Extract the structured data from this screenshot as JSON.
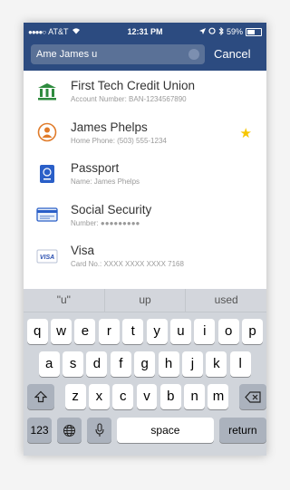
{
  "status_bar": {
    "carrier": "AT&T",
    "time": "12:31 PM",
    "battery": "59%",
    "battery_level": 0.59
  },
  "search": {
    "query": "Ame James u",
    "cancel_label": "Cancel"
  },
  "results": [
    {
      "icon": "bank-icon",
      "title": "First Tech Credit Union",
      "subtitle": "Account Number: BAN-1234567890",
      "favorite": false
    },
    {
      "icon": "contact-icon",
      "title": "James Phelps",
      "subtitle": "Home Phone: (503) 555-1234",
      "favorite": true
    },
    {
      "icon": "passport-icon",
      "title": "Passport",
      "subtitle": "Name: James Phelps",
      "favorite": false
    },
    {
      "icon": "id-card-icon",
      "title": "Social Security",
      "subtitle": "Number: ●●●●●●●●●",
      "favorite": false
    },
    {
      "icon": "credit-card-icon",
      "title": "Visa",
      "subtitle": "Card No.: XXXX XXXX XXXX 7168",
      "favorite": false
    }
  ],
  "keyboard": {
    "suggestions": [
      "\"u\"",
      "up",
      "used"
    ],
    "row1": [
      "q",
      "w",
      "e",
      "r",
      "t",
      "y",
      "u",
      "i",
      "o",
      "p"
    ],
    "row2": [
      "a",
      "s",
      "d",
      "f",
      "g",
      "h",
      "j",
      "k",
      "l"
    ],
    "row3": [
      "z",
      "x",
      "c",
      "v",
      "b",
      "n",
      "m"
    ],
    "numbers_label": "123",
    "space_label": "space",
    "return_label": "return"
  },
  "colors": {
    "header": "#2c4b80",
    "star": "#f7c600",
    "bank": "#2e8b3e",
    "contact": "#e07b2a",
    "passport": "#2a5fc8"
  }
}
